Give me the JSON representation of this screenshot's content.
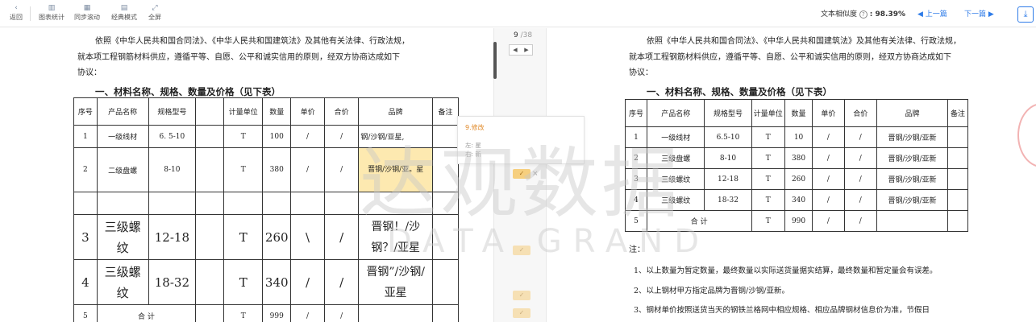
{
  "toolbar": {
    "back": {
      "icon": "chevron-left-icon",
      "glyph": "‹",
      "label": "返回"
    },
    "stats": {
      "icon": "bar-chart-icon",
      "glyph": "▥",
      "label": "图表统计"
    },
    "sync": {
      "icon": "columns-icon",
      "glyph": "▦",
      "label": "同步滚动"
    },
    "classic": {
      "icon": "document-icon",
      "glyph": "▤",
      "label": "经典模式"
    },
    "fullscreen": {
      "icon": "expand-icon",
      "glyph": "⤢",
      "label": "全屏"
    },
    "similarity_label": "文本相似度",
    "similarity_help": "?",
    "similarity_value": ": 98.39%",
    "prev": "◀ 上一篇",
    "next": "下一篇 ▶",
    "download_glyph": "⤓"
  },
  "page_indicator": {
    "current": "9",
    "total": "/38",
    "prev_glyph": "◀",
    "next_glyph": "▶"
  },
  "popup": {
    "title": "9.修改",
    "left_label": "左: 星",
    "right_label": "右: 新"
  },
  "mark_glyph": "✓",
  "mark_close": "×",
  "accent_color": "#2f7ce8",
  "highlight_color": "#f6cf7e",
  "watermark": {
    "cn": "达观数据",
    "en": "DATA GRAND"
  },
  "left_doc": {
    "para1": "依照《中华人民共和国合同法》、《中华人民共和国建筑法》及其他有关法律、行政法规，",
    "para2": "就本项工程钢筋材料供应，遵循平等、自愿、公平和诚实信用的原则，经双方协商达成如下",
    "para3": "协议：",
    "heading": "一、材料名称、规格、数量及价格（见下表）",
    "headers": [
      "序号",
      "产品名称",
      "规格型号",
      "",
      "计量单位",
      "数量",
      "单价",
      "合价",
      "品牌",
      "备注"
    ],
    "rows": [
      {
        "no": "1",
        "name": "一级线材",
        "spec": "6. 5-10",
        "blank": "",
        "unit": "T",
        "qty": "100",
        "price": "/",
        "total": "/",
        "brand": "钢/沙钢/亚星,",
        "note": ""
      },
      {
        "no": "2",
        "name": "二级盘螺",
        "spec": "8-10",
        "blank": "",
        "unit": "T",
        "qty": "380",
        "price": "/",
        "total": "/",
        "brand": "晋钢/沙钢/亚。星",
        "note": ""
      },
      {
        "no": "",
        "name": "",
        "spec": "",
        "blank": "",
        "unit": "",
        "qty": "",
        "price": "",
        "total": "",
        "brand": "",
        "note": ""
      },
      {
        "no": "3",
        "name": "三级螺纹",
        "spec": "12-18",
        "blank": "",
        "unit": "T",
        "qty": "260",
        "price": "\\",
        "total": "/",
        "brand": "晋钢！/沙钢？/亚星",
        "note": ""
      },
      {
        "no": "4",
        "name": "三级螺纹",
        "spec": "18-32",
        "blank": "",
        "unit": "T",
        "qty": "340",
        "price": "/",
        "total": "/",
        "brand": "晋钢”/沙钢/亚星",
        "note": ""
      },
      {
        "no": "5",
        "name": "合 计",
        "spec": "",
        "blank": "",
        "unit": "T",
        "qty": "999",
        "price": "/",
        "total": "/",
        "brand": "",
        "note": ""
      }
    ]
  },
  "right_doc": {
    "para1": "依照《中华人民共和国合同法》、《中华人民共和国建筑法》及其他有关法律、行政法规，",
    "para2": "就本项工程钢筋材料供应，遵循平等、自愿、公平和诚实信用的原则，经双方协商达成如下",
    "para3": "协议：",
    "heading": "一、材料名称、规格、数量及价格（见下表）",
    "headers": [
      "序号",
      "产品名称",
      "规格型号",
      "计量单位",
      "数量",
      "单价",
      "合价",
      "品牌",
      "备注"
    ],
    "rows": [
      {
        "no": "1",
        "name": "一级线材",
        "spec": "6.5-10",
        "unit": "T",
        "qty": "10",
        "price": "/",
        "total": "/",
        "brand": "晋钢/沙钢/亚新",
        "note": ""
      },
      {
        "no": "2",
        "name": "三级盘螺",
        "spec": "8-10",
        "unit": "T",
        "qty": "380",
        "price": "/",
        "total": "/",
        "brand": "晋钢/沙钢/亚新",
        "note": ""
      },
      {
        "no": "3",
        "name": "三级螺纹",
        "spec": "12-18",
        "unit": "T",
        "qty": "260",
        "price": "/",
        "total": "/",
        "brand": "晋钢/沙钢/亚新",
        "note": ""
      },
      {
        "no": "4",
        "name": "三级螺纹",
        "spec": "18-32",
        "unit": "T",
        "qty": "340",
        "price": "/",
        "total": "/",
        "brand": "晋钢/沙钢/亚新",
        "note": ""
      },
      {
        "no": "5",
        "name": "合 计",
        "spec": "",
        "unit": "T",
        "qty": "990",
        "price": "/",
        "total": "/",
        "brand": "",
        "note": ""
      }
    ],
    "note_label": "注：",
    "note1": "1、以上数量为暂定数量，最终数量以实际送货量据实结算，最终数量和暂定量会有误差。",
    "note2": "2、以上钢材甲方指定品牌为晋钢/沙钢/亚新。",
    "note3": "3、钢材单价按照送货当天的钢铁兰格网中相应规格、相应品牌钢材信息价为准，节假日"
  }
}
